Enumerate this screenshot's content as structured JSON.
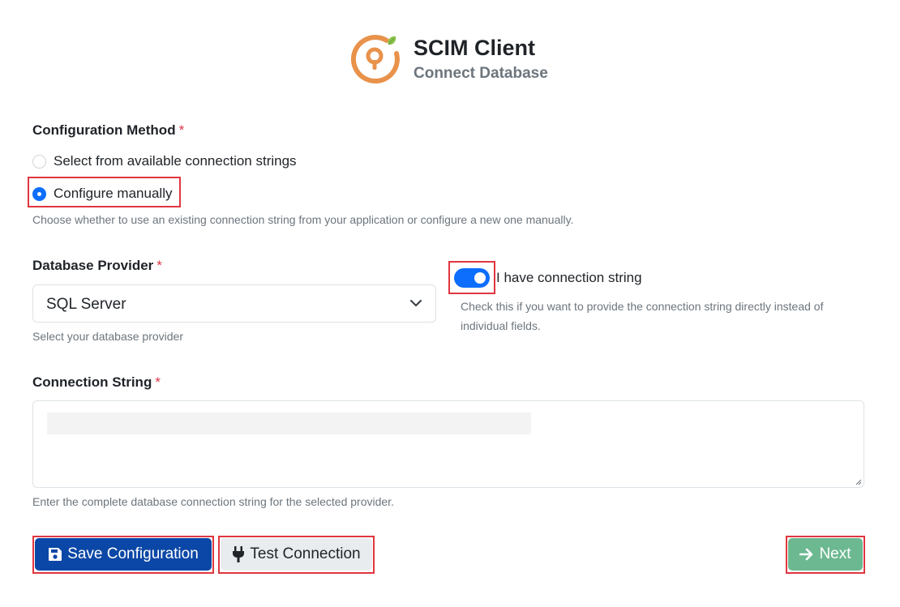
{
  "header": {
    "app_title": "SCIM Client",
    "app_subtitle": "Connect Database",
    "logo_icon": "keyhole-ring-logo-icon",
    "logo_colors": {
      "ring": "#e8924b",
      "leaf": "#8bc34a"
    }
  },
  "config_method": {
    "label": "Configuration Method",
    "required_mark": "*",
    "options": [
      {
        "label": "Select from available connection strings",
        "checked": false
      },
      {
        "label": "Configure manually",
        "checked": true
      }
    ],
    "help": "Choose whether to use an existing connection string from your application or configure a new one manually."
  },
  "database_provider": {
    "label": "Database Provider",
    "required_mark": "*",
    "selected": "SQL Server",
    "help": "Select your database provider",
    "chevron_icon": "chevron-down-icon"
  },
  "connection_toggle": {
    "label": "I have connection string",
    "on": true,
    "help": "Check this if you want to provide the connection string directly instead of individual fields."
  },
  "connection_string": {
    "label": "Connection String",
    "required_mark": "*",
    "help": "Enter the complete database connection string for the selected provider."
  },
  "buttons": {
    "save": {
      "label": "Save Configuration",
      "icon": "floppy-disk-icon"
    },
    "test": {
      "label": "Test Connection",
      "icon": "plug-icon"
    },
    "next": {
      "label": "Next",
      "icon": "arrow-right-icon"
    }
  },
  "colors": {
    "primary": "#0d6efd",
    "save_button": "#0b47a6",
    "next_button": "#6cb891",
    "required": "#dc3545",
    "highlight_box": "#e0363f"
  }
}
